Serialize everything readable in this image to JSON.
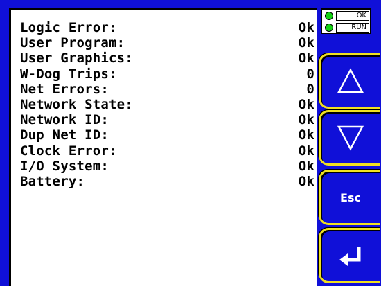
{
  "status": {
    "rows": [
      {
        "label": "Logic Error:",
        "value": "Ok"
      },
      {
        "label": "User Program:",
        "value": "Ok"
      },
      {
        "label": "User Graphics:",
        "value": "Ok"
      },
      {
        "label": "W-Dog Trips:",
        "value": "0"
      },
      {
        "label": "Net Errors:",
        "value": "0"
      },
      {
        "label": "Network State:",
        "value": "Ok"
      },
      {
        "label": "Network ID:",
        "value": "Ok"
      },
      {
        "label": "Dup Net ID:",
        "value": "Ok"
      },
      {
        "label": "Clock Error:",
        "value": "Ok"
      },
      {
        "label": "I/O System:",
        "value": "Ok"
      },
      {
        "label": "Battery:",
        "value": "Ok"
      }
    ]
  },
  "indicators": {
    "ok_label": "OK",
    "run_label": "RUN",
    "led_color": "#14d214"
  },
  "keys": {
    "up_icon": "up-triangle-icon",
    "down_icon": "down-triangle-icon",
    "esc_label": "Esc",
    "enter_icon": "enter-arrow-icon",
    "key_border_color": "#f0e020"
  },
  "colors": {
    "background": "#1010d8",
    "panel": "#ffffff"
  }
}
